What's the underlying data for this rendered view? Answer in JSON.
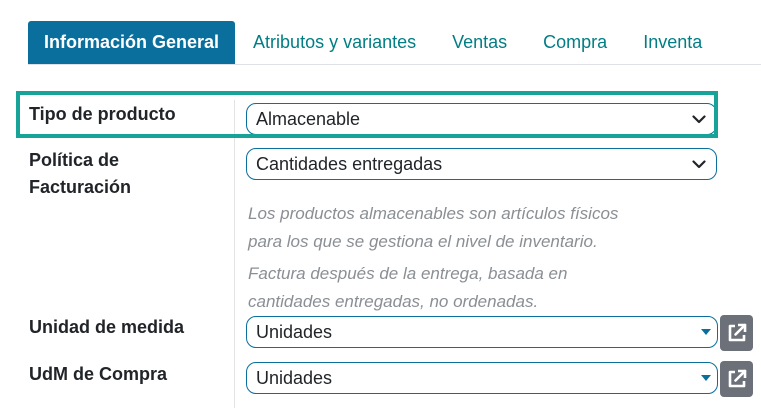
{
  "tabs": [
    {
      "label": "Información General",
      "active": true
    },
    {
      "label": "Atributos y variantes",
      "active": false
    },
    {
      "label": "Ventas",
      "active": false
    },
    {
      "label": "Compra",
      "active": false
    },
    {
      "label": "Inventa",
      "active": false
    }
  ],
  "fields": {
    "product_type": {
      "label": "Tipo de producto",
      "value": "Almacenable"
    },
    "invoice_policy": {
      "label_line1": "Política de",
      "label_line2": "Facturación",
      "value": "Cantidades entregadas"
    },
    "uom": {
      "label": "Unidad de medida",
      "value": "Unidades"
    },
    "purchase_uom": {
      "label": "UdM de Compra",
      "value": "Unidades"
    }
  },
  "help": {
    "storable_line1": "Los productos almacenables son artículos físicos",
    "storable_line2": "para los que se gestiona el nivel de inventario.",
    "invoice_line1": "Factura después de la entrega, basada en",
    "invoice_line2": "cantidades entregadas, no ordenadas."
  },
  "colors": {
    "accent": "#0a6f9c",
    "tab_link": "#017e84",
    "highlight": "#17a398",
    "button": "#6c7079"
  },
  "icons": {
    "select": "chevron-down-icon",
    "many2one": "caret-down-icon",
    "external": "external-link-icon"
  }
}
